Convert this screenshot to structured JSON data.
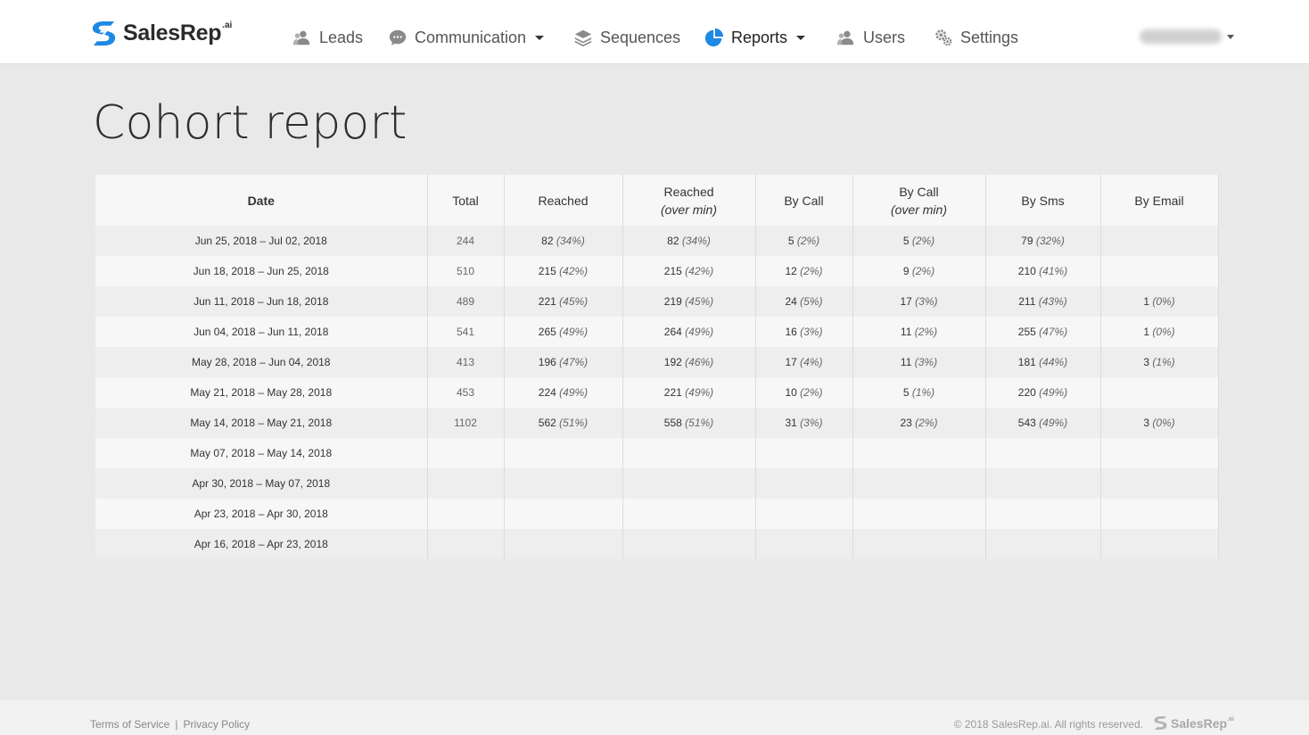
{
  "brand": {
    "name": "SalesRep",
    "sup": ".ai",
    "logo_icon": "salesrep-logo-icon",
    "accent": "#1e88e5"
  },
  "nav": {
    "items": [
      {
        "label": "Leads",
        "icon": "users-icon",
        "dropdown": false,
        "active": false
      },
      {
        "label": "Communication",
        "icon": "chat-bubble-icon",
        "dropdown": true,
        "active": false
      },
      {
        "label": "Sequences",
        "icon": "layers-icon",
        "dropdown": false,
        "active": false
      },
      {
        "label": "Reports",
        "icon": "pie-chart-icon",
        "dropdown": true,
        "active": true
      },
      {
        "label": "Users",
        "icon": "users-icon",
        "dropdown": false,
        "active": false
      },
      {
        "label": "Settings",
        "icon": "gear-icon",
        "dropdown": false,
        "active": false
      }
    ]
  },
  "page": {
    "title": "Cohort report"
  },
  "table": {
    "columns": [
      {
        "label": "Date",
        "sub": ""
      },
      {
        "label": "Total",
        "sub": ""
      },
      {
        "label": "Reached",
        "sub": ""
      },
      {
        "label": "Reached",
        "sub": "(over min)"
      },
      {
        "label": "By Call",
        "sub": ""
      },
      {
        "label": "By Call",
        "sub": "(over min)"
      },
      {
        "label": "By Sms",
        "sub": ""
      },
      {
        "label": "By Email",
        "sub": ""
      }
    ],
    "rows": [
      {
        "date": "Jun 25, 2018 – Jul 02, 2018",
        "total": "244",
        "reached": [
          "82",
          "(34%)"
        ],
        "reached_over": [
          "82",
          "(34%)"
        ],
        "call": [
          "5",
          "(2%)"
        ],
        "call_over": [
          "5",
          "(2%)"
        ],
        "sms": [
          "79",
          "(32%)"
        ],
        "email": [
          "",
          ""
        ]
      },
      {
        "date": "Jun 18, 2018 – Jun 25, 2018",
        "total": "510",
        "reached": [
          "215",
          "(42%)"
        ],
        "reached_over": [
          "215",
          "(42%)"
        ],
        "call": [
          "12",
          "(2%)"
        ],
        "call_over": [
          "9",
          "(2%)"
        ],
        "sms": [
          "210",
          "(41%)"
        ],
        "email": [
          "",
          ""
        ]
      },
      {
        "date": "Jun 11, 2018 – Jun 18, 2018",
        "total": "489",
        "reached": [
          "221",
          "(45%)"
        ],
        "reached_over": [
          "219",
          "(45%)"
        ],
        "call": [
          "24",
          "(5%)"
        ],
        "call_over": [
          "17",
          "(3%)"
        ],
        "sms": [
          "211",
          "(43%)"
        ],
        "email": [
          "1",
          "(0%)"
        ]
      },
      {
        "date": "Jun 04, 2018 – Jun 11, 2018",
        "total": "541",
        "reached": [
          "265",
          "(49%)"
        ],
        "reached_over": [
          "264",
          "(49%)"
        ],
        "call": [
          "16",
          "(3%)"
        ],
        "call_over": [
          "11",
          "(2%)"
        ],
        "sms": [
          "255",
          "(47%)"
        ],
        "email": [
          "1",
          "(0%)"
        ]
      },
      {
        "date": "May 28, 2018 – Jun 04, 2018",
        "total": "413",
        "reached": [
          "196",
          "(47%)"
        ],
        "reached_over": [
          "192",
          "(46%)"
        ],
        "call": [
          "17",
          "(4%)"
        ],
        "call_over": [
          "11",
          "(3%)"
        ],
        "sms": [
          "181",
          "(44%)"
        ],
        "email": [
          "3",
          "(1%)"
        ]
      },
      {
        "date": "May 21, 2018 – May 28, 2018",
        "total": "453",
        "reached": [
          "224",
          "(49%)"
        ],
        "reached_over": [
          "221",
          "(49%)"
        ],
        "call": [
          "10",
          "(2%)"
        ],
        "call_over": [
          "5",
          "(1%)"
        ],
        "sms": [
          "220",
          "(49%)"
        ],
        "email": [
          "",
          ""
        ]
      },
      {
        "date": "May 14, 2018 – May 21, 2018",
        "total": "1102",
        "reached": [
          "562",
          "(51%)"
        ],
        "reached_over": [
          "558",
          "(51%)"
        ],
        "call": [
          "31",
          "(3%)"
        ],
        "call_over": [
          "23",
          "(2%)"
        ],
        "sms": [
          "543",
          "(49%)"
        ],
        "email": [
          "3",
          "(0%)"
        ]
      },
      {
        "date": "May 07, 2018 – May 14, 2018",
        "total": "",
        "reached": [
          "",
          ""
        ],
        "reached_over": [
          "",
          ""
        ],
        "call": [
          "",
          ""
        ],
        "call_over": [
          "",
          ""
        ],
        "sms": [
          "",
          ""
        ],
        "email": [
          "",
          ""
        ]
      },
      {
        "date": "Apr 30, 2018 – May 07, 2018",
        "total": "",
        "reached": [
          "",
          ""
        ],
        "reached_over": [
          "",
          ""
        ],
        "call": [
          "",
          ""
        ],
        "call_over": [
          "",
          ""
        ],
        "sms": [
          "",
          ""
        ],
        "email": [
          "",
          ""
        ]
      },
      {
        "date": "Apr 23, 2018 – Apr 30, 2018",
        "total": "",
        "reached": [
          "",
          ""
        ],
        "reached_over": [
          "",
          ""
        ],
        "call": [
          "",
          ""
        ],
        "call_over": [
          "",
          ""
        ],
        "sms": [
          "",
          ""
        ],
        "email": [
          "",
          ""
        ]
      },
      {
        "date": "Apr 16, 2018 – Apr 23, 2018",
        "total": "",
        "reached": [
          "",
          ""
        ],
        "reached_over": [
          "",
          ""
        ],
        "call": [
          "",
          ""
        ],
        "call_over": [
          "",
          ""
        ],
        "sms": [
          "",
          ""
        ],
        "email": [
          "",
          ""
        ]
      }
    ]
  },
  "footer": {
    "terms": "Terms of Service",
    "separator": "|",
    "privacy": "Privacy Policy",
    "copyright": "© 2018 SalesRep.ai. All rights reserved.",
    "brand_name": "SalesRep",
    "brand_sup": ".ai"
  }
}
